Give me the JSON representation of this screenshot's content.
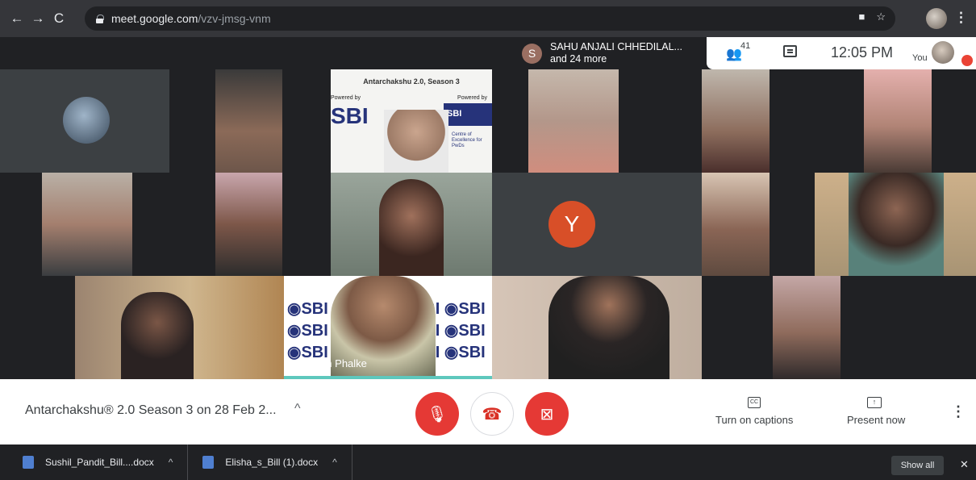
{
  "browser": {
    "back_glyph": "←",
    "forward_glyph": "→",
    "reload_glyph": "C",
    "url_host": "meet.google.com",
    "url_path": "/vzv-jmsg-vnm",
    "camera_glyph": "■",
    "star_glyph": "☆",
    "kebab_glyph": "⋮"
  },
  "meet_header": {
    "pill_initial": "S",
    "participant_name": "SAHU ANJALI CHHEDILAL...",
    "participant_more": "and 24 more",
    "people_glyph": "👥",
    "people_count": "41",
    "time": "12:05 PM",
    "you_label": "You"
  },
  "tiles": {
    "y_initial": "Y",
    "ganesh_name": "Ganesh Phalke",
    "slide_title_1": "Antarchakshu 2.0, Season 3",
    "powered_by": "Powered by",
    "sbi_logo_text": "SBI",
    "centre_excellence": "Centre of Excellence for PwDs",
    "sbi_row": "◉SBI ◉SBI ◉SBI ◉SBI",
    "sbi_row_short": "◉SBI ◉S",
    "sbi_row_right": "SBI ◉SBI"
  },
  "controls": {
    "meeting_title": "Antarchakshu® 2.0 Season 3 on 28 Feb 2...",
    "chevron": "^",
    "mic_glyph": "🎙",
    "end_glyph": "☎",
    "cam_glyph": "⊠",
    "captions_glyph": "CC",
    "captions_label": "Turn on captions",
    "present_glyph": "↑",
    "present_label": "Present now",
    "more_glyph": "⋮"
  },
  "downloads": {
    "file1": "Sushil_Pandit_Bill....docx",
    "file2": "Elisha_s_Bill (1).docx",
    "chevron": "^",
    "show_all": "Show all",
    "close": "✕"
  },
  "colors": {
    "meet_dark": "#202124",
    "browser_bar": "#35363a",
    "end_red": "#d93025",
    "muted_red": "#e53935",
    "y_avatar": "#d84f28",
    "sbi_blue": "#26337a"
  }
}
